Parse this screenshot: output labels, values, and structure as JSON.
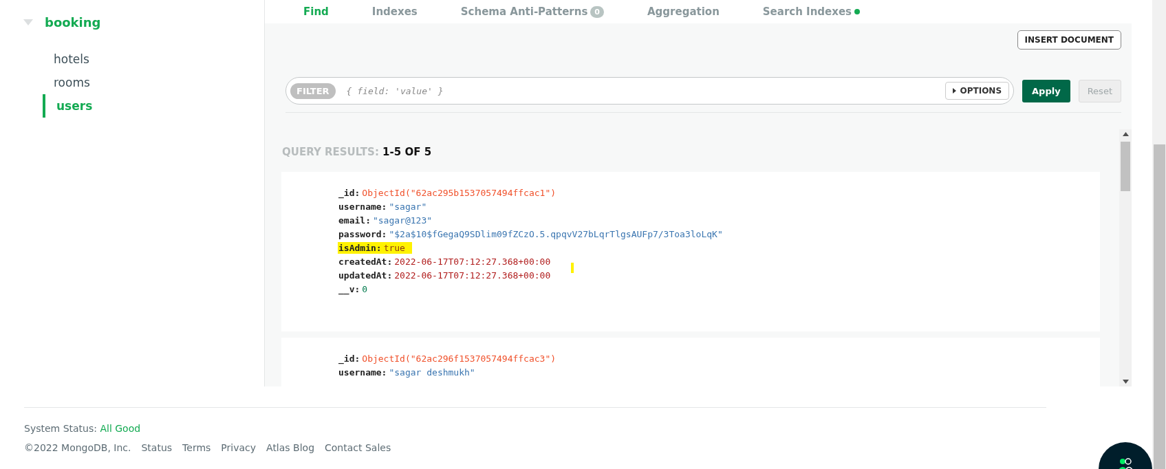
{
  "sidebar": {
    "database": {
      "name": "booking",
      "expanded": true
    },
    "collections": [
      {
        "name": "hotels",
        "selected": false
      },
      {
        "name": "rooms",
        "selected": false
      },
      {
        "name": "users",
        "selected": true
      }
    ]
  },
  "tabs": [
    {
      "label": "Find",
      "selected": true
    },
    {
      "label": "Indexes",
      "selected": false
    },
    {
      "label": "Schema Anti-Patterns",
      "selected": false,
      "badge": "0"
    },
    {
      "label": "Aggregation",
      "selected": false
    },
    {
      "label": "Search Indexes",
      "selected": false,
      "status_dot": true
    }
  ],
  "insert_button": "INSERT DOCUMENT",
  "filter": {
    "label": "FILTER",
    "placeholder": "{ field: 'value' }",
    "options_button": "OPTIONS",
    "apply_button": "Apply",
    "reset_button": "Reset"
  },
  "results": {
    "label": "QUERY RESULTS:",
    "range": "1-5 OF 5"
  },
  "documents": [
    {
      "fields": [
        {
          "key": "_id:",
          "value": "ObjectId(\"62ac295b1537057494ffcac1\")",
          "kind": "objectid",
          "highlighted": false
        },
        {
          "key": "username:",
          "value": "\"sagar\"",
          "kind": "string",
          "highlighted": false
        },
        {
          "key": "email:",
          "value": "\"sagar@123\"",
          "kind": "string",
          "highlighted": false
        },
        {
          "key": "password:",
          "value": "\"$2a$10$fGegaQ9SDlim09fZCzO.5.qpqvV27bLqrTlgsAUFp7/3Toa3loLqK\"",
          "kind": "string",
          "highlighted": false
        },
        {
          "key": "isAdmin:",
          "value": "true",
          "kind": "bool",
          "highlighted": true
        },
        {
          "key": "createdAt:",
          "value": "2022-06-17T07:12:27.368+00:00",
          "kind": "date",
          "highlighted": false
        },
        {
          "key": "updatedAt:",
          "value": "2022-06-17T07:12:27.368+00:00",
          "kind": "date",
          "highlighted": false
        },
        {
          "key": "__v:",
          "value": "0",
          "kind": "number",
          "highlighted": false
        }
      ]
    },
    {
      "fields": [
        {
          "key": "_id:",
          "value": "ObjectId(\"62ac296f1537057494ffcac3\")",
          "kind": "objectid",
          "highlighted": false
        },
        {
          "key": "username:",
          "value": "\"sagar deshmukh\"",
          "kind": "string",
          "highlighted": false
        }
      ]
    }
  ],
  "footer": {
    "status_label": "System Status:",
    "status_value": "All Good",
    "copyright": "©2022 MongoDB, Inc.",
    "links": [
      "Status",
      "Terms",
      "Privacy",
      "Atlas Blog",
      "Contact Sales"
    ]
  }
}
